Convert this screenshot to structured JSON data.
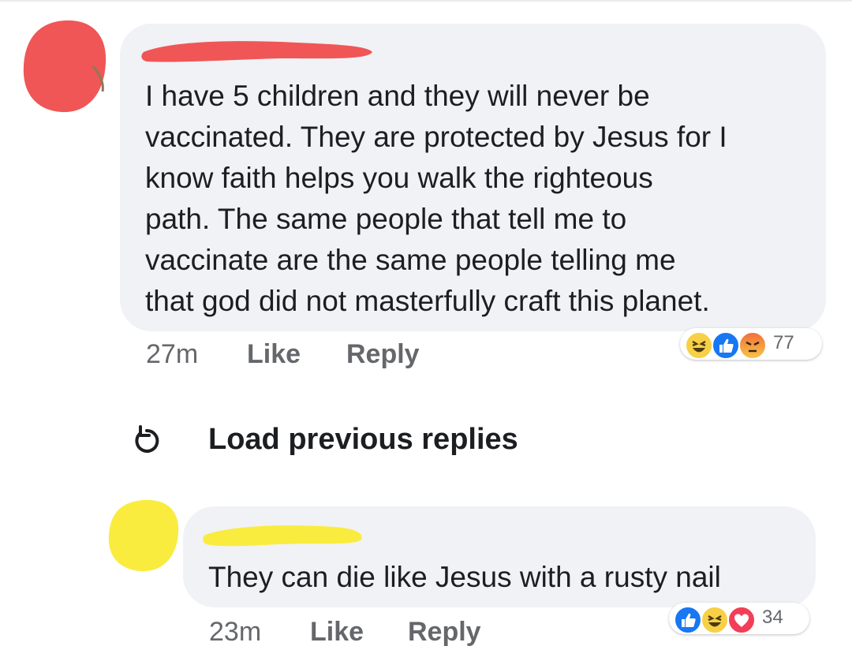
{
  "comments": [
    {
      "text": "I have 5 children and they will never be\nvaccinated. They are protected by Jesus for I\nknow faith helps you walk the righteous\npath. The same people that tell me to\nvaccinate are the same people telling me\nthat god did not masterfully craft this planet.",
      "time": "27m",
      "like_label": "Like",
      "reply_label": "Reply",
      "reaction_count": "77",
      "reaction_icons": [
        "haha-icon",
        "like-icon",
        "angry-icon"
      ],
      "avatar_color": "#f05656"
    },
    {
      "text": "They can die like Jesus with a rusty nail",
      "time": "23m",
      "like_label": "Like",
      "reply_label": "Reply",
      "reaction_count": "34",
      "reaction_icons": [
        "like-icon",
        "haha-icon",
        "love-icon"
      ],
      "avatar_color": "#f9ec3e"
    }
  ],
  "load_previous": {
    "label": "Load previous replies",
    "icon": "refresh-icon"
  },
  "colors": {
    "bubble": "#f0f2f5",
    "meta_text": "#65676b",
    "like_blue": "#1877f2",
    "haha_yellow": "#f7d046",
    "angry_orange": "#f0713a",
    "love_red": "#f33e58"
  }
}
